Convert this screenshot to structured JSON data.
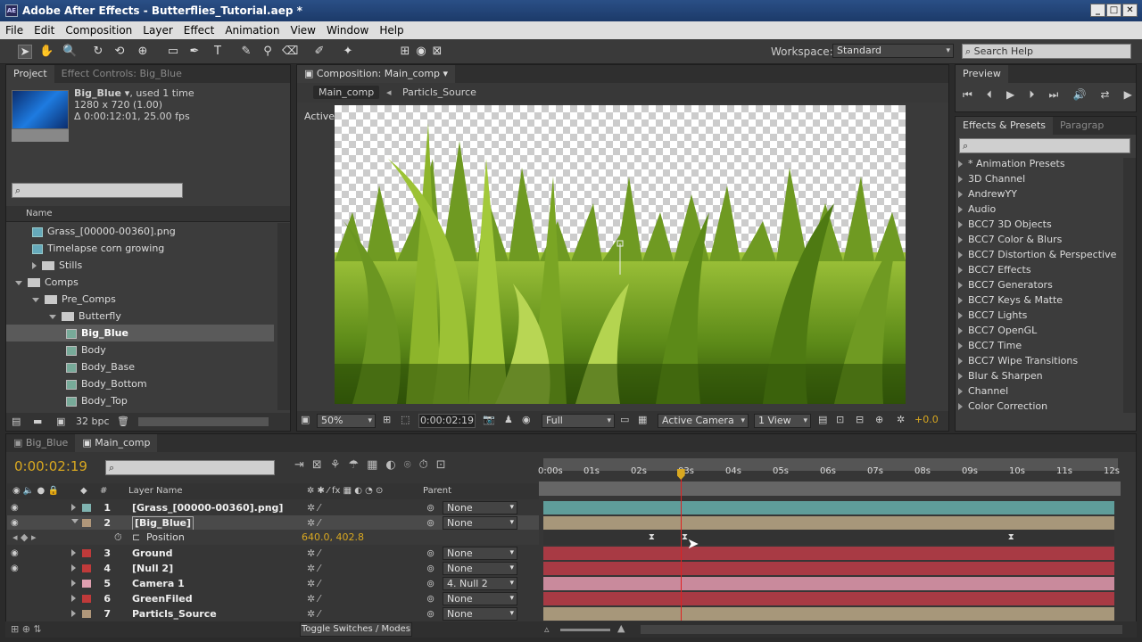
{
  "window": {
    "title": "Adobe After Effects - Butterflies_Tutorial.aep *",
    "logo": "AE",
    "min": "_",
    "max": "□",
    "close": "✕"
  },
  "menu": [
    "File",
    "Edit",
    "Composition",
    "Layer",
    "Effect",
    "Animation",
    "View",
    "Window",
    "Help"
  ],
  "workspace": {
    "label": "Workspace:",
    "value": "Standard"
  },
  "search_help": "Search Help",
  "project": {
    "tab": "Project",
    "tab2": "Effect Controls: Big_Blue",
    "item_name": "Big_Blue ▾",
    "item_used": ", used 1 time",
    "item_res": "1280 x 720 (1.00)",
    "item_dur": "Δ 0:00:12:01, 25.00 fps",
    "col_name": "Name",
    "items": [
      {
        "label": "Grass_[00000-00360].png",
        "type": "file",
        "indent": 1
      },
      {
        "label": "Timelapse corn growing",
        "type": "file",
        "indent": 1
      },
      {
        "label": "Stills",
        "type": "folder",
        "indent": 1,
        "open": false
      },
      {
        "label": "Comps",
        "type": "folder",
        "indent": 0,
        "open": true
      },
      {
        "label": "Pre_Comps",
        "type": "folder",
        "indent": 1,
        "open": true
      },
      {
        "label": "Butterfly",
        "type": "folder",
        "indent": 2,
        "open": true
      },
      {
        "label": "Big_Blue",
        "type": "comp",
        "indent": 3,
        "selected": true
      },
      {
        "label": "Body",
        "type": "comp",
        "indent": 3
      },
      {
        "label": "Body_Base",
        "type": "comp",
        "indent": 3
      },
      {
        "label": "Body_Bottom",
        "type": "comp",
        "indent": 3
      },
      {
        "label": "Body_Top",
        "type": "comp",
        "indent": 3
      }
    ],
    "bpc": "32 bpc"
  },
  "composition": {
    "tab": "Composition: Main_comp",
    "crumbs": [
      "Main_comp",
      "Particls_Source"
    ],
    "camera_label": "Active Camera",
    "zoom": "50%",
    "time": "0:00:02:19",
    "quality": "Full",
    "view_camera": "Active Camera",
    "views": "1 View",
    "exposure": "+0.0"
  },
  "preview": {
    "tab": "Preview"
  },
  "effects": {
    "tab": "Effects & Presets",
    "tab2": "Paragrap",
    "items": [
      "* Animation Presets",
      "3D Channel",
      "AndrewYY",
      "Audio",
      "BCC7 3D Objects",
      "BCC7 Color & Blurs",
      "BCC7 Distortion & Perspective",
      "BCC7 Effects",
      "BCC7 Generators",
      "BCC7 Keys & Matte",
      "BCC7 Lights",
      "BCC7 OpenGL",
      "BCC7 Time",
      "BCC7 Wipe Transitions",
      "Blur & Sharpen",
      "Channel",
      "Color Correction"
    ]
  },
  "timeline": {
    "tabs": [
      "Big_Blue",
      "Main_comp"
    ],
    "timecode": "0:00:02:19",
    "col_layer": "Layer Name",
    "col_parent": "Parent",
    "col_num": "#",
    "ticks": [
      "0:00s",
      "01s",
      "02s",
      "03s",
      "04s",
      "05s",
      "06s",
      "07s",
      "08s",
      "09s",
      "10s",
      "11s",
      "12s"
    ],
    "playhead_sec": 2.9,
    "layers": [
      {
        "num": "1",
        "name": "[Grass_[00000-00360].png]",
        "label": "#7fb3b0",
        "parent": "None",
        "bar": "#5f9d9a"
      },
      {
        "num": "2",
        "name": "[Big_Blue]",
        "label": "#b0977a",
        "parent": "None",
        "bar": "#a7977a",
        "selected": true
      },
      {
        "num": "3",
        "name": "Ground",
        "label": "#c03a3a",
        "parent": "None",
        "bar": "#a83a44"
      },
      {
        "num": "4",
        "name": "[Null 2]",
        "label": "#c03a3a",
        "parent": "None",
        "bar": "#a83a44"
      },
      {
        "num": "5",
        "name": "Camera 1",
        "label": "#e0a0b0",
        "parent": "4. Null 2",
        "bar": "#c98a9c"
      },
      {
        "num": "6",
        "name": "GreenFiled",
        "label": "#c03a3a",
        "parent": "None",
        "bar": "#a83a44"
      },
      {
        "num": "7",
        "name": "Particls_Source",
        "label": "#b0977a",
        "parent": "None",
        "bar": "#a7977a"
      }
    ],
    "position_label": "Position",
    "position_value": "640.0, 402.8",
    "keyframes_sec": [
      2.3,
      3.0,
      9.9
    ],
    "toggle": "Toggle Switches / Modes"
  },
  "colors": {
    "accent": "#d9a820",
    "playhead": "#e02020"
  }
}
